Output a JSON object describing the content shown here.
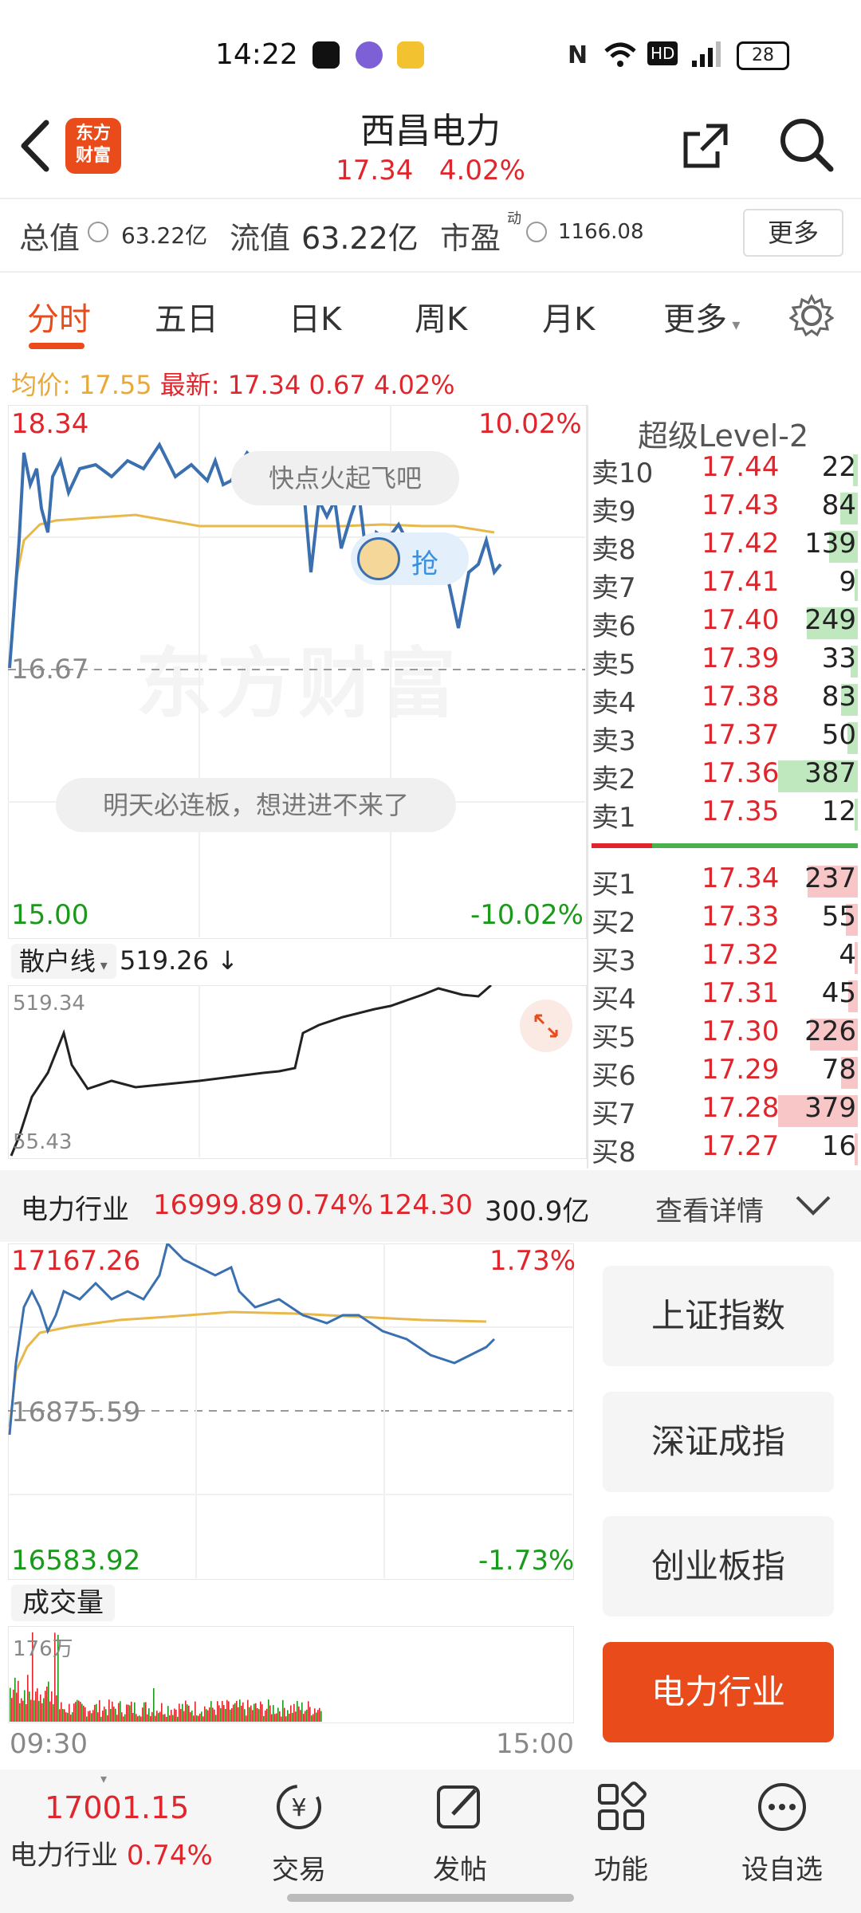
{
  "status_bar": {
    "time": "14:22",
    "battery": "28"
  },
  "header": {
    "logo_text_line1": "东方",
    "logo_text_line2": "财富",
    "stock_name": "西昌电力",
    "price": "17.34",
    "change_pct": "4.02%"
  },
  "info_row": {
    "total_value_label": "总值",
    "total_value": "63.22亿",
    "float_value_label": "流值",
    "float_value": "63.22亿",
    "pe_label": "市盈",
    "pe_sup": "动",
    "pe_value": "1166.08",
    "more_label": "更多"
  },
  "tabs": [
    "分时",
    "五日",
    "日K",
    "周K",
    "月K",
    "更多"
  ],
  "price_line": {
    "avg_label": "均价:",
    "avg_value": "17.55",
    "latest_label": "最新:",
    "latest_value": "17.34",
    "change": "0.67",
    "change_pct": "4.02%"
  },
  "main_chart": {
    "top_price": "18.34",
    "top_pct": "10.02%",
    "mid_price": "16.67",
    "bottom_price": "15.00",
    "bottom_pct": "-10.02%",
    "watermark": "东方财富",
    "bubble1": "快点火起飞吧",
    "bubble2": "明天必连板，想进进不来了",
    "bubble_badge": "抢"
  },
  "sub_chart": {
    "indicator": "散户线",
    "indicator_value": "519.26",
    "max": "519.34",
    "min": "55.43"
  },
  "order_book": {
    "title": "超级Level-2",
    "sell": [
      {
        "name": "卖10",
        "price": "17.44",
        "vol": "22",
        "ratio": 0.06
      },
      {
        "name": "卖9",
        "price": "17.43",
        "vol": "84",
        "ratio": 0.22
      },
      {
        "name": "卖8",
        "price": "17.42",
        "vol": "139",
        "ratio": 0.36
      },
      {
        "name": "卖7",
        "price": "17.41",
        "vol": "9",
        "ratio": 0.02
      },
      {
        "name": "卖6",
        "price": "17.40",
        "vol": "249",
        "ratio": 0.64
      },
      {
        "name": "卖5",
        "price": "17.39",
        "vol": "33",
        "ratio": 0.09
      },
      {
        "name": "卖4",
        "price": "17.38",
        "vol": "83",
        "ratio": 0.21
      },
      {
        "name": "卖3",
        "price": "17.37",
        "vol": "50",
        "ratio": 0.13
      },
      {
        "name": "卖2",
        "price": "17.36",
        "vol": "387",
        "ratio": 1.0
      },
      {
        "name": "卖1",
        "price": "17.35",
        "vol": "12",
        "ratio": 0.03
      }
    ],
    "buy": [
      {
        "name": "买1",
        "price": "17.34",
        "vol": "237",
        "ratio": 0.63
      },
      {
        "name": "买2",
        "price": "17.33",
        "vol": "55",
        "ratio": 0.15
      },
      {
        "name": "买3",
        "price": "17.32",
        "vol": "4",
        "ratio": 0.01
      },
      {
        "name": "买4",
        "price": "17.31",
        "vol": "45",
        "ratio": 0.12
      },
      {
        "name": "买5",
        "price": "17.30",
        "vol": "226",
        "ratio": 0.6
      },
      {
        "name": "买6",
        "price": "17.29",
        "vol": "78",
        "ratio": 0.21
      },
      {
        "name": "买7",
        "price": "17.28",
        "vol": "379",
        "ratio": 1.0
      },
      {
        "name": "买8",
        "price": "17.27",
        "vol": "16",
        "ratio": 0.04
      }
    ]
  },
  "industry_bar": {
    "name": "电力行业",
    "index": "16999.89",
    "pct": "0.74%",
    "change": "124.30",
    "amount": "300.9亿",
    "detail": "查看详情"
  },
  "industry_chart": {
    "top_value": "17167.26",
    "top_pct": "1.73%",
    "mid_value": "16875.59",
    "bottom_value": "16583.92",
    "bottom_pct": "-1.73%",
    "volume_label": "成交量",
    "volume_max": "176万",
    "time_start": "09:30",
    "time_end": "15:00"
  },
  "index_buttons": [
    "上证指数",
    "深证成指",
    "创业板指",
    "电力行业"
  ],
  "bottom_nav": {
    "index_value": "17001.15",
    "index_name": "电力行业",
    "index_pct": "0.74%",
    "items": [
      "交易",
      "发帖",
      "功能",
      "设自选"
    ]
  },
  "colors": {
    "up": "#e0262c",
    "down": "#1a9a1a",
    "brand": "#e94b1a",
    "line": "#3a6fb0",
    "avg": "#e8b84a"
  }
}
